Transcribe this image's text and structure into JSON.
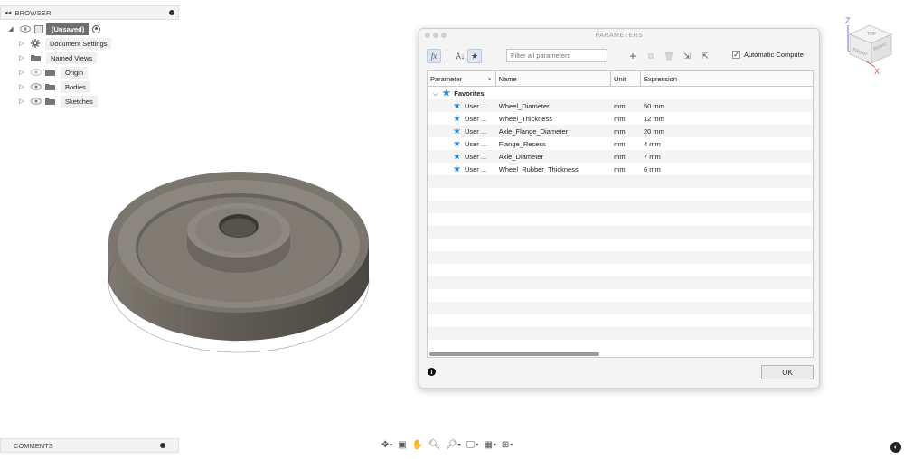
{
  "browser": {
    "title": "BROWSER",
    "root": "(Unsaved)",
    "items": [
      {
        "label": "Document Settings",
        "icon": "gear-icon"
      },
      {
        "label": "Named Views",
        "icon": "folder-icon"
      },
      {
        "label": "Origin",
        "icon": "folder-icon"
      },
      {
        "label": "Bodies",
        "icon": "folder-icon"
      },
      {
        "label": "Sketches",
        "icon": "folder-icon"
      }
    ]
  },
  "comments": {
    "title": "COMMENTS"
  },
  "viewcube": {
    "top": "TOP",
    "front": "FRONT",
    "right": "RIGHT",
    "z": "Z",
    "x": "X"
  },
  "dialog": {
    "title": "PARAMETERS",
    "filter_placeholder": "Filter all parameters",
    "auto_compute_label": "Automatic Compute",
    "auto_compute_checked": true,
    "columns": [
      "Parameter",
      "Name",
      "Unit",
      "Expression"
    ],
    "group": "Favorites",
    "rows": [
      {
        "param": "User ...",
        "name": "Wheel_Diameter",
        "unit": "mm",
        "expr": "50 mm"
      },
      {
        "param": "User ...",
        "name": "Wheel_Thickness",
        "unit": "mm",
        "expr": "12 mm"
      },
      {
        "param": "User ...",
        "name": "Axle_Flange_Diameter",
        "unit": "mm",
        "expr": "20 mm"
      },
      {
        "param": "User ...",
        "name": "Flange_Recess",
        "unit": "mm",
        "expr": "4 mm"
      },
      {
        "param": "User ...",
        "name": "Axle_Diameter",
        "unit": "mm",
        "expr": "7 mm"
      },
      {
        "param": "User ...",
        "name": "Wheel_Rubber_Thickness",
        "unit": "mm",
        "expr": "6 mm"
      }
    ],
    "ok_label": "OK",
    "info": "i"
  },
  "colors": {
    "accent": "#2a8ccf",
    "model": "#6e6a62"
  }
}
